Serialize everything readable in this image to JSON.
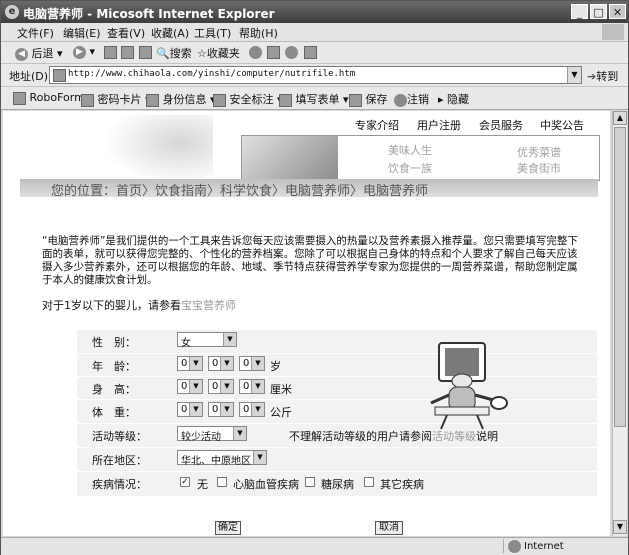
{
  "window": {
    "title": "电脑营养师 - Micosoft Internet Explorer",
    "controls": {
      "minimize": "_",
      "maximize": "□",
      "close": "✕"
    }
  },
  "menubar": [
    "文件(F)",
    "编辑(E)",
    "查看(V)",
    "收藏(A)",
    "工具(T)",
    "帮助(H)"
  ],
  "toolbar": {
    "back": "后退",
    "search": "搜索",
    "favorites": "收藏夹"
  },
  "address": {
    "label": "地址(D)",
    "url": "http://www.chihaola.com/yinshi/computer/nutrifile.htm",
    "go": "转到"
  },
  "linksbar": [
    "RoboForm",
    "密码卡片",
    "身份信息",
    "安全标注",
    "填写表单",
    "保存",
    "注销",
    "隐藏"
  ],
  "page": {
    "topnav": [
      "专家介绍",
      "用户注册",
      "会员服务",
      "中奖公告"
    ],
    "banner_links": [
      "美味人生",
      "饮食一族",
      "优秀菜谱",
      "美食街市"
    ],
    "breadcrumb": "您的位置：首页〉饮食指南〉科学饮食〉电脑营养师〉电脑营养师",
    "intro": "“电脑营养师”是我们提供的一个工具来告诉您每天应该需要摄入的热量以及营养素摄入推荐量。您只需要填写完整下面的表单，就可以获得您完整的、个性化的营养档案。您除了可以根据自己身体的特点和个人要求了解自己每天应该摄入多少营养素外，还可以根据您的年龄、地域、季节特点获得营养学专家为您提供的一周营养菜谱，帮助您制定属于本人的健康饮食计划。",
    "infant_prefix": "对于1岁以下的婴儿，请参看",
    "infant_link": "宝宝营养师"
  },
  "form": {
    "gender_label": "性　别：",
    "gender_value": "女",
    "age_label": "年　龄：",
    "age_digits": [
      "0",
      "0",
      "0"
    ],
    "age_unit": "岁",
    "height_label": "身　高：",
    "height_digits": [
      "0",
      "0",
      "0"
    ],
    "height_unit": "厘米",
    "weight_label": "体　重：",
    "weight_digits": [
      "0",
      "0",
      "0"
    ],
    "weight_unit": "公斤",
    "activity_label": "活动等级：",
    "activity_value": "较少活动",
    "activity_hint_prefix": "不理解活动等级的用户请参阅",
    "activity_hint_link": "活动等级",
    "activity_hint_suffix": "说明",
    "region_label": "所在地区：",
    "region_value": "华北、中原地区",
    "disease_label": "疾病情况：",
    "diseases": [
      {
        "label": "无",
        "checked": true
      },
      {
        "label": "心脑血管疾病",
        "checked": false
      },
      {
        "label": "糖尿病",
        "checked": false
      },
      {
        "label": "其它疾病",
        "checked": false
      }
    ],
    "submit": "确定",
    "cancel": "取消"
  },
  "statusbar": {
    "zone": "Internet"
  }
}
